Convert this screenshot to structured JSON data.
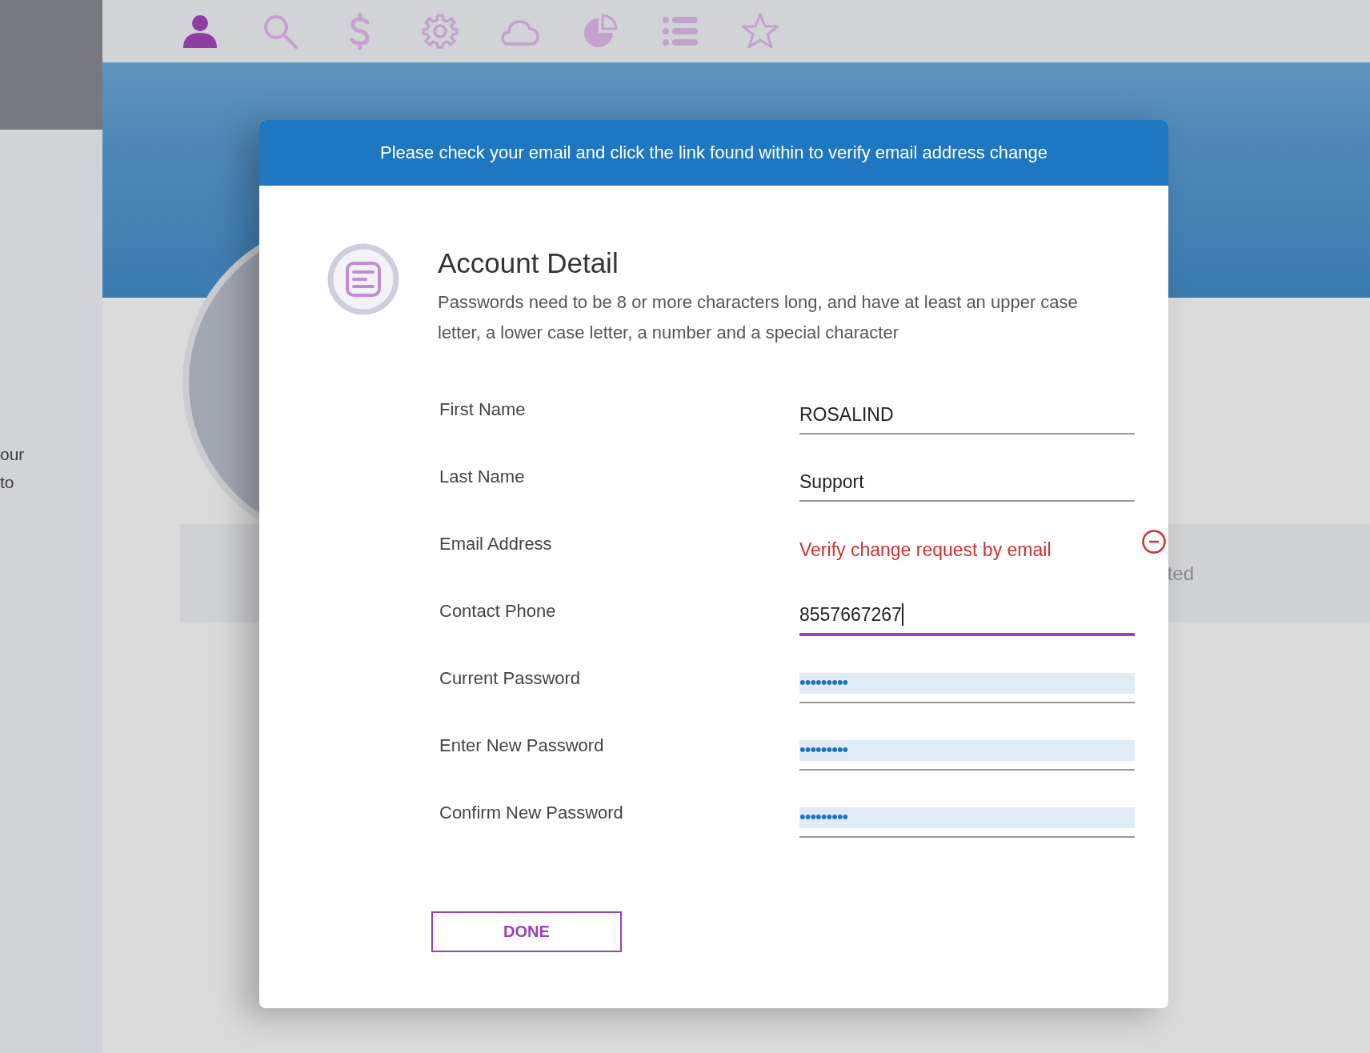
{
  "nav": {
    "icons": [
      {
        "kind": "person",
        "selected": true
      },
      {
        "kind": "search",
        "selected": false
      },
      {
        "kind": "dollar",
        "selected": false
      },
      {
        "kind": "gear",
        "selected": false
      },
      {
        "kind": "cloud",
        "selected": false
      },
      {
        "kind": "pie",
        "selected": false
      },
      {
        "kind": "list",
        "selected": false
      },
      {
        "kind": "star",
        "selected": false
      }
    ]
  },
  "background": {
    "side_text": [
      "our",
      "to"
    ],
    "band_text": "ted"
  },
  "banner": "Please check your email and click the link found within to verify email address change",
  "dialog": {
    "title": "Account Detail",
    "description": "Passwords need to be 8 or more characters long, and have at least an upper case letter, a lower case letter, a number and a special character",
    "fields": [
      {
        "label": "First Name",
        "kind": "text",
        "value": "ROSALIND",
        "focused": false
      },
      {
        "label": "Last Name",
        "kind": "text",
        "value": "Support",
        "focused": false
      },
      {
        "label": "Email Address",
        "kind": "status",
        "value": "Verify change request by email"
      },
      {
        "label": "Contact Phone",
        "kind": "text",
        "value": "8557667267",
        "focused": true
      },
      {
        "label": "Current Password",
        "kind": "password",
        "value": "•••••••••",
        "focused": false
      },
      {
        "label": "Enter New Password",
        "kind": "password",
        "value": "•••••••••",
        "focused": false
      },
      {
        "label": "Confirm New Password",
        "kind": "password",
        "value": "•••••••••",
        "focused": false
      }
    ],
    "done_button": "DONE"
  }
}
